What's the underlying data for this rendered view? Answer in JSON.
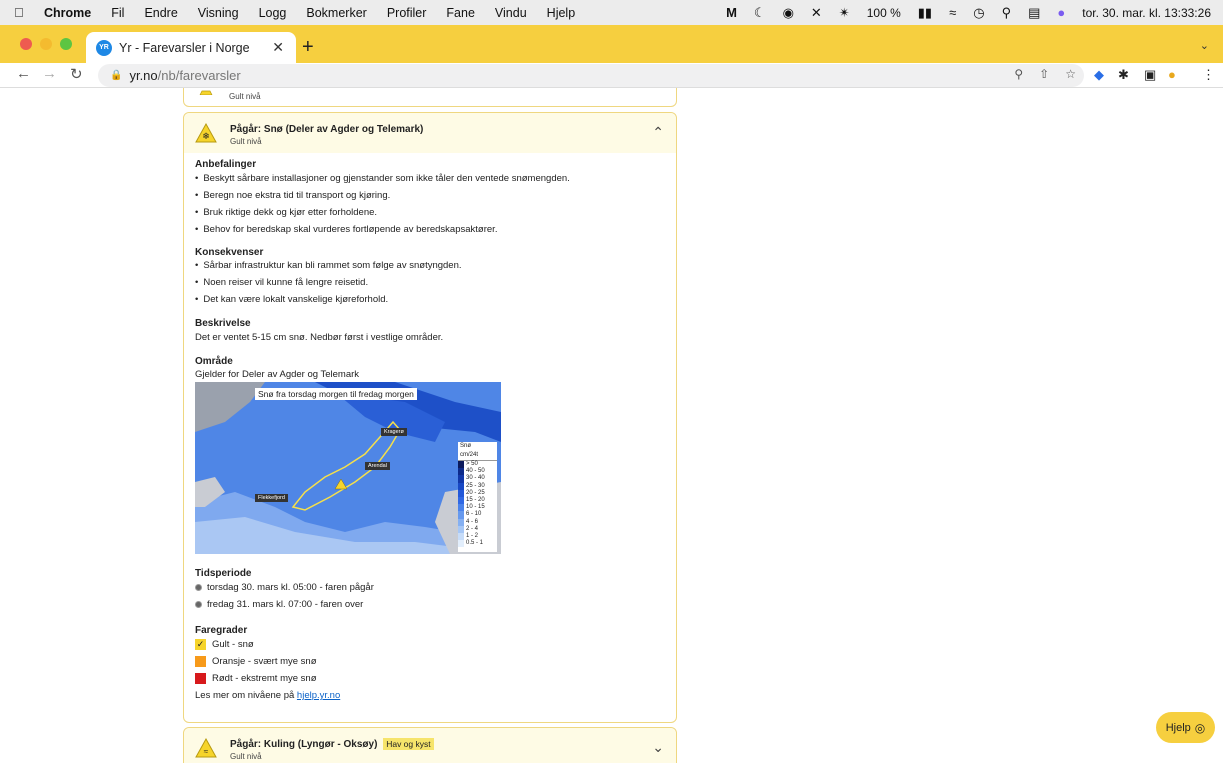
{
  "menubar": {
    "app": "Chrome",
    "items": [
      "Fil",
      "Endre",
      "Visning",
      "Logg",
      "Bokmerker",
      "Profiler",
      "Fane",
      "Vindu",
      "Hjelp"
    ],
    "battery": "100 %",
    "datetime": "tor. 30. mar. kl. 13:33:26"
  },
  "tab": {
    "title": "Yr - Farevarsler i Norge",
    "favicon": "YR"
  },
  "omnibox": {
    "host": "yr.no",
    "path": "/nb/farevarsler"
  },
  "top_card": {
    "level": "Gult nivå"
  },
  "main_card": {
    "title": "Pågår: Snø (Deler av Agder og Telemark)",
    "level": "Gult nivå",
    "recommendations_title": "Anbefalinger",
    "recommendations": [
      "Beskytt sårbare installasjoner og gjenstander som ikke tåler den ventede snømengden.",
      "Beregn noe ekstra tid til transport og kjøring.",
      "Bruk riktige dekk og kjør etter forholdene.",
      "Behov for beredskap skal vurderes fortløpende av beredskapsaktører."
    ],
    "consequences_title": "Konsekvenser",
    "consequences": [
      "Sårbar infrastruktur kan bli rammet som følge av snøtyngden.",
      "Noen reiser vil kunne få lengre reisetid.",
      "Det kan være lokalt vanskelige kjøreforhold."
    ],
    "description_title": "Beskrivelse",
    "description": "Det er ventet 5-15 cm snø. Nedbør først i vestlige områder.",
    "area_title": "Område",
    "area": "Gjelder for Deler av Agder og Telemark",
    "map": {
      "title": "Snø fra torsdag morgen til fredag morgen",
      "labels": [
        "Kragerø",
        "Arendal",
        "Flekkefjord"
      ],
      "legend_title": "Snø",
      "legend_unit": "cm/24t",
      "legend": [
        {
          "label": "> 50",
          "color": "#0b1a5c"
        },
        {
          "label": "40 - 50",
          "color": "#0d2a8a"
        },
        {
          "label": "30 - 40",
          "color": "#1237a8"
        },
        {
          "label": "25 - 30",
          "color": "#1848c4"
        },
        {
          "label": "20 - 25",
          "color": "#2358d8"
        },
        {
          "label": "15 - 20",
          "color": "#3068e4"
        },
        {
          "label": "10 - 15",
          "color": "#4a82ea"
        },
        {
          "label": "6 - 10",
          "color": "#6699ee"
        },
        {
          "label": "4 - 6",
          "color": "#85b0f2"
        },
        {
          "label": "2 - 4",
          "color": "#a6c7f6"
        },
        {
          "label": "1 - 2",
          "color": "#c6dcf9"
        },
        {
          "label": "0.5 - 1",
          "color": "#e2eefc"
        }
      ]
    },
    "period_title": "Tidsperiode",
    "period": [
      "torsdag 30. mars kl. 05:00 - faren pågår",
      "fredag 31. mars kl. 07:00 - faren over"
    ],
    "levels_title": "Faregrader",
    "levels": [
      {
        "label": "Gult - snø",
        "color": "#f6d42b",
        "checked": true
      },
      {
        "label": "Oransje - svært mye snø",
        "color": "#f79a1a",
        "checked": false
      },
      {
        "label": "Rødt - ekstremt mye snø",
        "color": "#d7191c",
        "checked": false
      }
    ],
    "more_prefix": "Les mer om nivåene på ",
    "more_link": "hjelp.yr.no"
  },
  "bottom_card": {
    "title": "Pågår: Kuling (Lyngør - Oksøy)",
    "tag": "Hav og kyst",
    "level": "Gult nivå"
  },
  "help_button": "Hjelp"
}
